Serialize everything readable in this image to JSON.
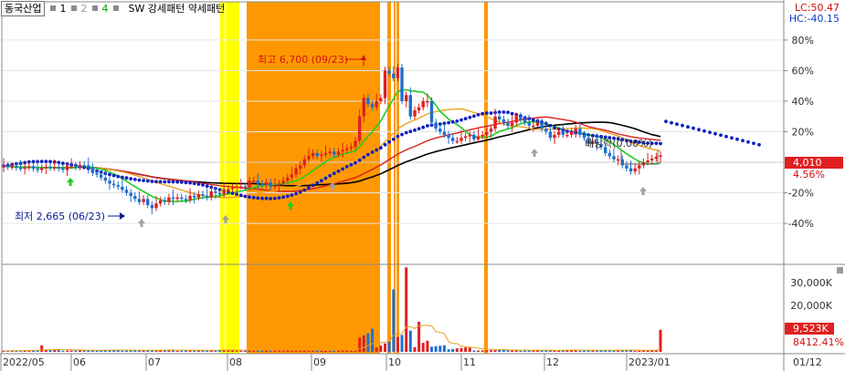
{
  "header": {
    "stock_name": "동국산업",
    "indicator_1": "1",
    "indicator_2": "2",
    "indicator_4": "4",
    "pattern_label": "SW 강세패턴  약세패턴"
  },
  "readouts": {
    "lc": "LC:50.47",
    "hc": "HC:-40.15"
  },
  "colors": {
    "bullish_zone": "#ff9800",
    "bearish_zone": "#ffff00",
    "candle_up": "#e02020",
    "candle_down": "#1e6fd0",
    "dotted_trend": "#1020c0",
    "ma_green": "#22cc22",
    "ma_orange": "#f0a020",
    "ma_red": "#d82020",
    "ma_black": "#000000"
  },
  "chart_data": {
    "type": "candlestick",
    "x_axis": {
      "labels": [
        "2022/05",
        "06",
        "07",
        "08",
        "09",
        "10",
        "11",
        "12",
        "2023/01",
        "01/12"
      ]
    },
    "price_axis": {
      "unit": "%",
      "tick_labels": [
        "80%",
        "60%",
        "40%",
        "20%",
        "-20%",
        "-40%"
      ],
      "ticks": [
        80,
        60,
        40,
        20,
        -20,
        -40
      ],
      "range": [
        -65,
        105
      ]
    },
    "annotations": {
      "high": "최고 6,700 (09/23)",
      "low": "최저 2,665 (06/23)",
      "dividend": "배당락(0.00%)"
    },
    "current": {
      "price": "4,010",
      "change": "4.56%",
      "change_value": 4.56
    },
    "volume_axis": {
      "tick_labels": [
        "30,000K",
        "20,000K"
      ],
      "ticks": [
        30000,
        20000
      ],
      "max": 37000
    },
    "volume_current": {
      "value": "9,523K",
      "ratio": "8412.41%"
    },
    "pct_series": [
      -2.4,
      -3,
      -2.8,
      -3.6,
      -4,
      -3.4,
      -2.6,
      -4.2,
      -5,
      -3.8,
      -2.8,
      -3.6,
      -3.2,
      -4,
      -5,
      -2.4,
      -2.4,
      -3.2,
      -1.8,
      -2,
      -3.2,
      -7,
      -8,
      -10,
      -12,
      -14,
      -15,
      -16,
      -18,
      -20,
      -22,
      -24,
      -26,
      -24,
      -28,
      -30,
      -27,
      -25,
      -26,
      -23,
      -24,
      -23,
      -24,
      -24.6,
      -22,
      -23,
      -21,
      -22,
      -23,
      -19,
      -20,
      -21,
      -18,
      -17.4,
      -16.6,
      -15.8,
      -15.8,
      -16.6,
      -12,
      -12,
      -14,
      -14.8,
      -13.2,
      -16,
      -15.2,
      -14,
      -12,
      -10,
      -8,
      -4,
      -2,
      2,
      4,
      6,
      4,
      5,
      6,
      7,
      5,
      7,
      8,
      9,
      10,
      14,
      30,
      42,
      38,
      36,
      40,
      42,
      60,
      58,
      55,
      62,
      40,
      44,
      30,
      34,
      36,
      40,
      40,
      26,
      22,
      20,
      18,
      16,
      14,
      14,
      16,
      17,
      18,
      15,
      17,
      18,
      20,
      22,
      30,
      28,
      26,
      24,
      26,
      30,
      28,
      26,
      24,
      24,
      26,
      22,
      20,
      16,
      18,
      20,
      18,
      18,
      20,
      22,
      18,
      16,
      12,
      14,
      12,
      10,
      6,
      4,
      2,
      2,
      -2,
      -4,
      -6,
      -4,
      -2,
      0,
      1.2,
      2.4,
      3.6,
      4.56
    ]
  }
}
